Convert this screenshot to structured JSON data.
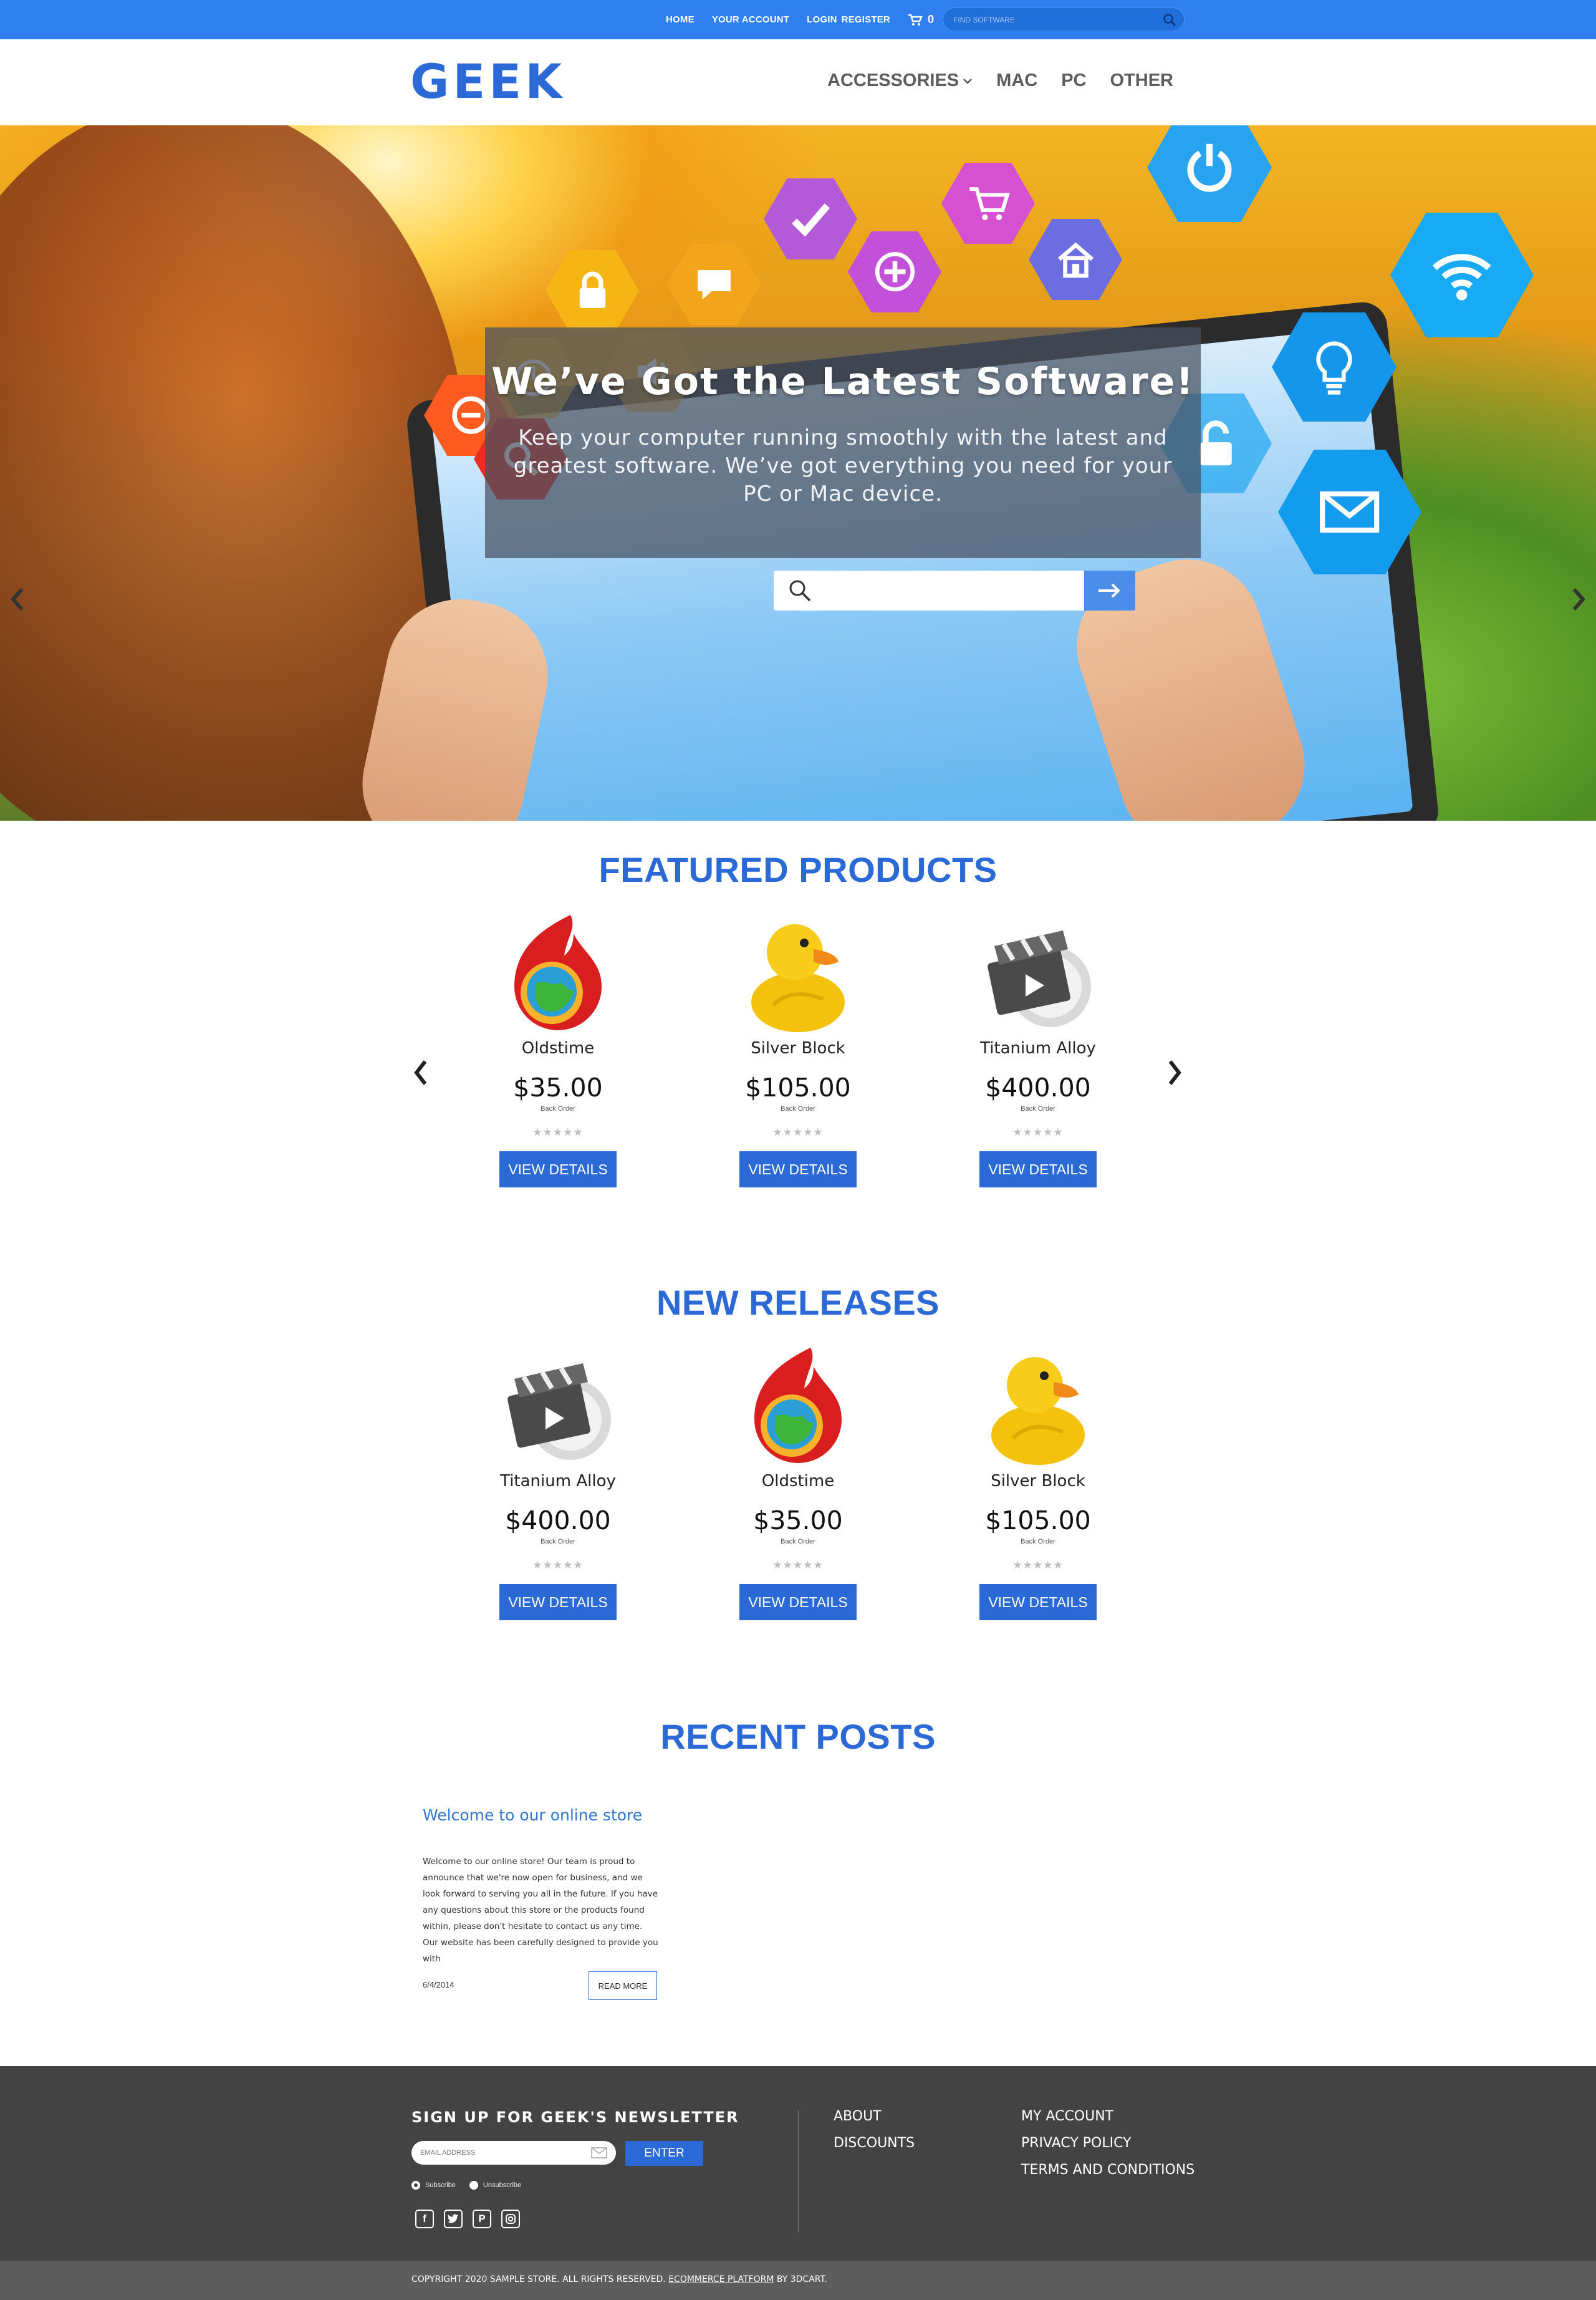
{
  "topbar": {
    "links": [
      "HOME",
      "YOUR ACCOUNT",
      "LOGIN",
      "REGISTER"
    ],
    "cart_count": "0",
    "search_placeholder": "FIND SOFTWARE",
    "colors": {
      "bar": "#2f7ff0"
    }
  },
  "header": {
    "logo": "GEEK",
    "nav": [
      "ACCESSORIES",
      "MAC",
      "PC",
      "OTHER"
    ],
    "colors": {
      "brand": "#2b6ad6",
      "nav_text": "#5d5d5d"
    }
  },
  "hero": {
    "title": "We’ve Got the Latest Software!",
    "subtitle": "Keep your computer running smoothly with the latest and greatest software. We’ve got everything you need for your PC or Mac device.",
    "search_placeholder": "",
    "icons": [
      "minus-icon",
      "clock-icon",
      "lock-icon",
      "speaker-icon",
      "speech-bubble-icon",
      "check-icon",
      "plus-icon",
      "cart-icon",
      "home-icon",
      "power-icon",
      "wifi-icon",
      "lightbulb-icon",
      "unlock-icon",
      "envelope-icon",
      "search-icon"
    ]
  },
  "featured": {
    "title": "FEATURED PRODUCTS",
    "products": [
      {
        "name": "Oldstime",
        "price": "$35.00",
        "status": "Back Order",
        "button": "VIEW DETAILS",
        "icon": "flame-globe-icon"
      },
      {
        "name": "Silver Block",
        "price": "$105.00",
        "status": "Back Order",
        "button": "VIEW DETAILS",
        "icon": "rubber-duck-icon"
      },
      {
        "name": "Titanium Alloy",
        "price": "$400.00",
        "status": "Back Order",
        "button": "VIEW DETAILS",
        "icon": "clapperboard-icon"
      }
    ]
  },
  "releases": {
    "title": "NEW RELEASES",
    "products": [
      {
        "name": "Titanium Alloy",
        "price": "$400.00",
        "status": "Back Order",
        "button": "VIEW DETAILS",
        "icon": "clapperboard-icon"
      },
      {
        "name": "Oldstime",
        "price": "$35.00",
        "status": "Back Order",
        "button": "VIEW DETAILS",
        "icon": "flame-globe-icon"
      },
      {
        "name": "Silver Block",
        "price": "$105.00",
        "status": "Back Order",
        "button": "VIEW DETAILS",
        "icon": "rubber-duck-icon"
      }
    ]
  },
  "recent_posts": {
    "title": "RECENT POSTS",
    "post": {
      "title": "Welcome to our online store",
      "body": "Welcome to our online store! Our team is proud to announce that we're now open for business, and we look forward to serving you all in the future. If you have any questions about this store or the products found within, please don't hesitate to contact us any time. Our website has been carefully designed to provide you with",
      "date": "6/4/2014",
      "button": "READ MORE"
    }
  },
  "footer": {
    "newsletter_title": "SIGN UP FOR GEEK'S NEWSLETTER",
    "email_placeholder": "EMAIL ADDRESS",
    "enter_label": "ENTER",
    "subscribe_label": "Subscribe",
    "unsubscribe_label": "Unsubscribe",
    "socials": [
      "facebook-icon",
      "twitter-icon",
      "pinterest-icon",
      "instagram-icon"
    ],
    "col1": [
      "ABOUT",
      "DISCOUNTS"
    ],
    "col2": [
      "MY ACCOUNT",
      "PRIVACY POLICY",
      "TERMS AND CONDITIONS"
    ],
    "copyright_prefix": "COPYRIGHT 2020 SAMPLE STORE. ALL RIGHTS RESERVED.",
    "copyright_link": "ECOMMERCE PLATFORM",
    "copyright_suffix": "BY 3DCART."
  }
}
